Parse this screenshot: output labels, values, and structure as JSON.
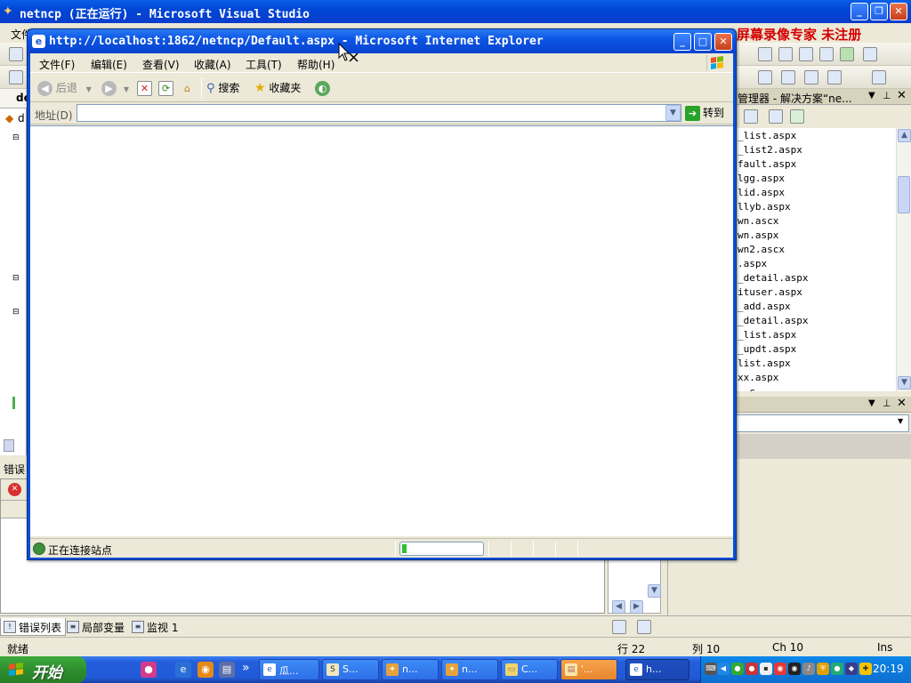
{
  "vs": {
    "title": "netncp (正在运行) - Microsoft Visual Studio",
    "menubar_visible": "文件",
    "watermark": "屏幕录像专家 未注册",
    "doc_tab": "de",
    "editor_item": "d",
    "solution_explorer": {
      "title": "管理器 - 解决方案“ne...",
      "files": [
        "_list.aspx",
        "_list2.aspx",
        "fault.aspx",
        "lgg.aspx",
        "lid.aspx",
        "llyb.aspx",
        "wn.ascx",
        "wn.aspx",
        "wn2.ascx",
        ".aspx",
        "_detail.aspx",
        "ituser.aspx",
        "_add.aspx",
        "_detail.aspx",
        "_list.aspx",
        "_updt.aspx",
        "list.aspx",
        "xx.aspx",
        "__c"
      ]
    },
    "error_list_header": "错误",
    "bottom_tabs": [
      {
        "label": "错误列表"
      },
      {
        "label": "局部变量"
      },
      {
        "label": "监视 1"
      }
    ],
    "statusbar": {
      "ready": "就绪",
      "row": "行 22",
      "col": "列 10",
      "ch": "Ch 10",
      "ins": "Ins"
    }
  },
  "ie": {
    "title": "http://localhost:1862/netncp/Default.aspx - Microsoft Internet Explorer",
    "menus": [
      "文件(F)",
      "编辑(E)",
      "查看(V)",
      "收藏(A)",
      "工具(T)",
      "帮助(H)"
    ],
    "toolbar": {
      "back": "后退",
      "search": "搜索",
      "favorites": "收藏夹"
    },
    "address_label": "地址(D)",
    "address_value": "",
    "go_label": "转到",
    "status_text": "正在连接站点",
    "progress": 0.06
  },
  "taskbar": {
    "start_label": "开始",
    "quicklaunch_more": "»",
    "tasks": [
      {
        "label": "瓜..."
      },
      {
        "label": "S..."
      },
      {
        "label": "n..."
      },
      {
        "label": "n..."
      },
      {
        "label": "C..."
      },
      {
        "label": "'..."
      },
      {
        "label": "h..."
      }
    ],
    "clock": "20:19"
  },
  "colors": {
    "xp_blue": "#0a5ee8",
    "start_green": "#2e8f2e",
    "watermark_red": "#d40000",
    "progress_green": "#2fc12f"
  }
}
